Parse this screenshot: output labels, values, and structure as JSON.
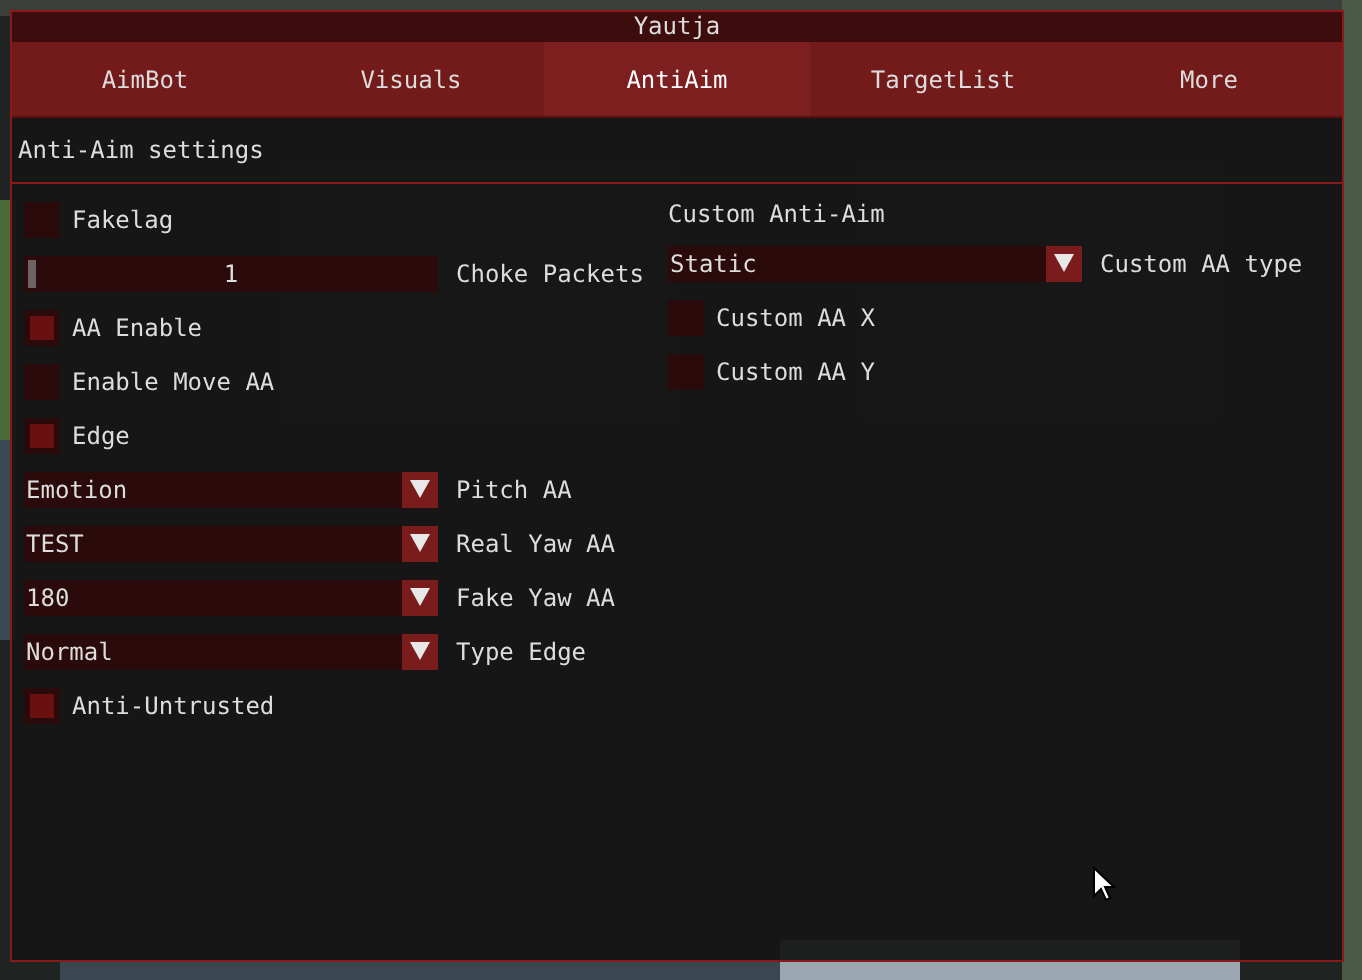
{
  "window": {
    "title": "Yautja"
  },
  "tabs": [
    {
      "label": "AimBot",
      "selected": false
    },
    {
      "label": "Visuals",
      "selected": false
    },
    {
      "label": "AntiAim",
      "selected": true
    },
    {
      "label": "TargetList",
      "selected": false
    },
    {
      "label": "More",
      "selected": false
    }
  ],
  "section_title": "Anti-Aim settings",
  "left_controls": [
    {
      "kind": "checkbox",
      "label": "Fakelag",
      "checked": false
    },
    {
      "kind": "slider",
      "label": "Choke Packets",
      "value": "1",
      "level": 0
    },
    {
      "kind": "checkbox",
      "label": "AA Enable",
      "checked": true
    },
    {
      "kind": "checkbox",
      "label": "Enable Move AA",
      "checked": false
    },
    {
      "kind": "checkbox",
      "label": "Edge",
      "checked": true
    },
    {
      "kind": "dropdown",
      "label": "Pitch AA",
      "selection": "Emotion"
    },
    {
      "kind": "dropdown",
      "label": "Real Yaw AA",
      "selection": "TEST"
    },
    {
      "kind": "dropdown",
      "label": "Fake Yaw AA",
      "selection": "180"
    },
    {
      "kind": "dropdown",
      "label": "Type Edge",
      "selection": "Normal"
    },
    {
      "kind": "checkbox",
      "label": "Anti-Untrusted",
      "checked": true
    }
  ],
  "right_group": {
    "title": "Custom Anti-Aim",
    "controls": [
      {
        "kind": "dropdown",
        "label": "Custom AA type",
        "selection": "Static"
      },
      {
        "kind": "checkbox",
        "label": "Custom AA X",
        "checked": false
      },
      {
        "kind": "checkbox",
        "label": "Custom AA Y",
        "checked": false
      }
    ]
  }
}
